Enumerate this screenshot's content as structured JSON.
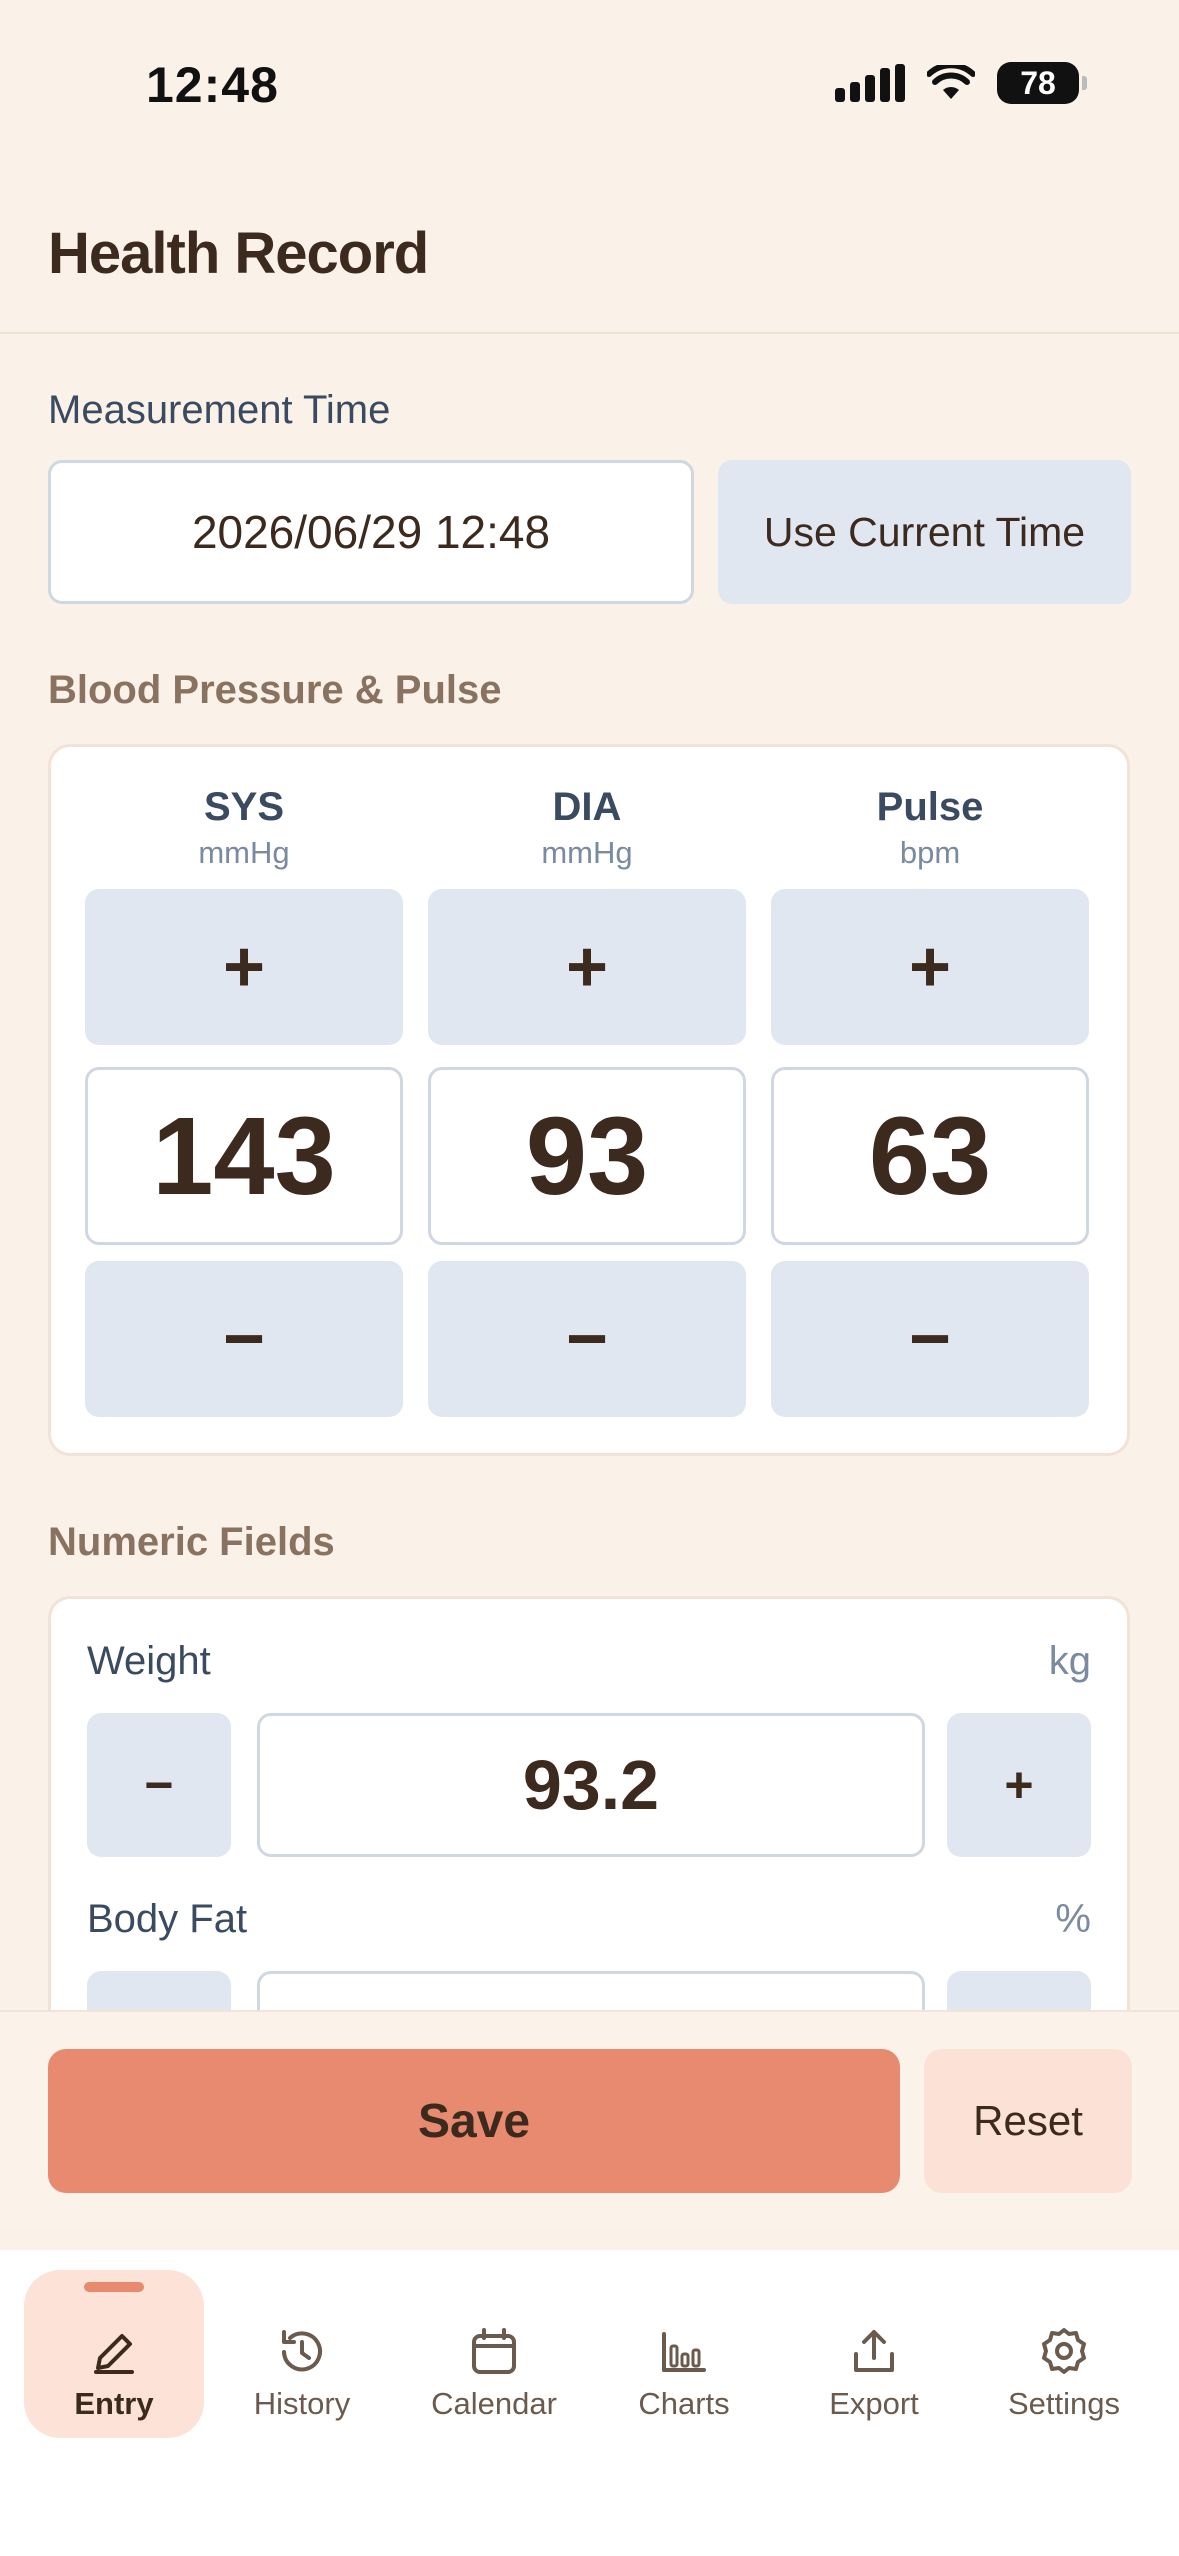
{
  "status_bar": {
    "time": "12:48",
    "battery": "78"
  },
  "header": {
    "title": "Health Record"
  },
  "measurement_time": {
    "label": "Measurement Time",
    "value": "2026/06/29 12:48",
    "use_current_label": "Use Current Time"
  },
  "blood_pressure": {
    "section_label": "Blood Pressure & Pulse",
    "plus_symbol": "+",
    "minus_symbol": "−",
    "columns": [
      {
        "name": "SYS",
        "unit": "mmHg",
        "value": "143"
      },
      {
        "name": "DIA",
        "unit": "mmHg",
        "value": "93"
      },
      {
        "name": "Pulse",
        "unit": "bpm",
        "value": "63"
      }
    ]
  },
  "numeric_fields": {
    "section_label": "Numeric Fields",
    "minus_symbol": "−",
    "plus_symbol": "+",
    "items": [
      {
        "label": "Weight",
        "unit": "kg",
        "value": "93.2"
      },
      {
        "label": "Body Fat",
        "unit": "%",
        "value": ""
      }
    ]
  },
  "actions": {
    "save_label": "Save",
    "reset_label": "Reset"
  },
  "tabs": [
    {
      "label": "Entry",
      "icon": "pencil-icon",
      "active": true
    },
    {
      "label": "History",
      "icon": "history-icon",
      "active": false
    },
    {
      "label": "Calendar",
      "icon": "calendar-icon",
      "active": false
    },
    {
      "label": "Charts",
      "icon": "chart-icon",
      "active": false
    },
    {
      "label": "Export",
      "icon": "export-icon",
      "active": false
    },
    {
      "label": "Settings",
      "icon": "gear-icon",
      "active": false
    }
  ],
  "colors": {
    "background": "#faf2e8",
    "accent": "#e88a70",
    "accent_soft": "#fde3d7",
    "button_gray": "#e1e7f0",
    "text_dark": "#3d2a1f"
  }
}
